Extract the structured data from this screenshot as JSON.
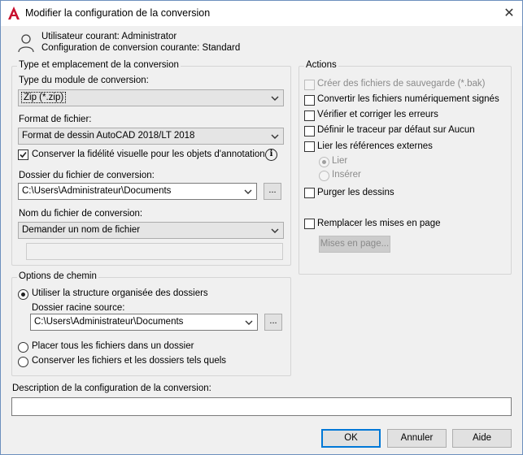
{
  "window": {
    "title": "Modifier la configuration de la conversion",
    "close_glyph": "✕"
  },
  "user": {
    "current_user": "Utilisateur courant: Administrator",
    "current_config": "Configuration de conversion courante: Standard"
  },
  "type_group": {
    "label": "Type et emplacement de la conversion",
    "module_label": "Type du module de conversion:",
    "module_value": "Zip (*.zip)",
    "format_label": "Format de fichier:",
    "format_value": "Format de dessin AutoCAD 2018/LT 2018",
    "keep_fidelity_label": "Conserver la fidélité visuelle pour les objets d'annotation",
    "keep_fidelity_checked": true,
    "info_glyph": "i",
    "folder_label": "Dossier du fichier de conversion:",
    "folder_value": "C:\\Users\\Administrateur\\Documents",
    "folder_browse": "...",
    "name_label": "Nom du fichier de conversion:",
    "name_value": "Demander un nom de fichier"
  },
  "actions_group": {
    "label": "Actions",
    "items": [
      {
        "label": "Créer des fichiers de sauvegarde (*.bak)",
        "checked": false,
        "disabled": true
      },
      {
        "label": "Convertir les fichiers numériquement signés",
        "checked": false,
        "disabled": false
      },
      {
        "label": "Vérifier et corriger les erreurs",
        "checked": false,
        "disabled": false
      },
      {
        "label": "Définir le traceur par défaut sur Aucun",
        "checked": false,
        "disabled": false
      },
      {
        "label": "Lier les références externes",
        "checked": false,
        "disabled": false
      }
    ],
    "radio_bind": "Lier",
    "radio_insert": "Insérer",
    "purge_label": "Purger les dessins",
    "replace_layouts_label": "Remplacer les mises en page",
    "layouts_button": "Mises en page..."
  },
  "path_group": {
    "label": "Options de chemin",
    "use_structure": "Utiliser la structure organisée des dossiers",
    "source_root_label": "Dossier racine source:",
    "source_root_value": "C:\\Users\\Administrateur\\Documents",
    "source_browse": "...",
    "place_all": "Placer tous les fichiers dans un dossier",
    "keep_as_is": "Conserver les fichiers et les dossiers tels quels"
  },
  "description": {
    "label": "Description de la configuration de la conversion:",
    "value": ""
  },
  "buttons": {
    "ok": "OK",
    "cancel": "Annuler",
    "help": "Aide"
  },
  "colors": {
    "accent": "#0078d7",
    "app_red": "#c8102e",
    "dialog_bg": "#f0f0f0"
  }
}
